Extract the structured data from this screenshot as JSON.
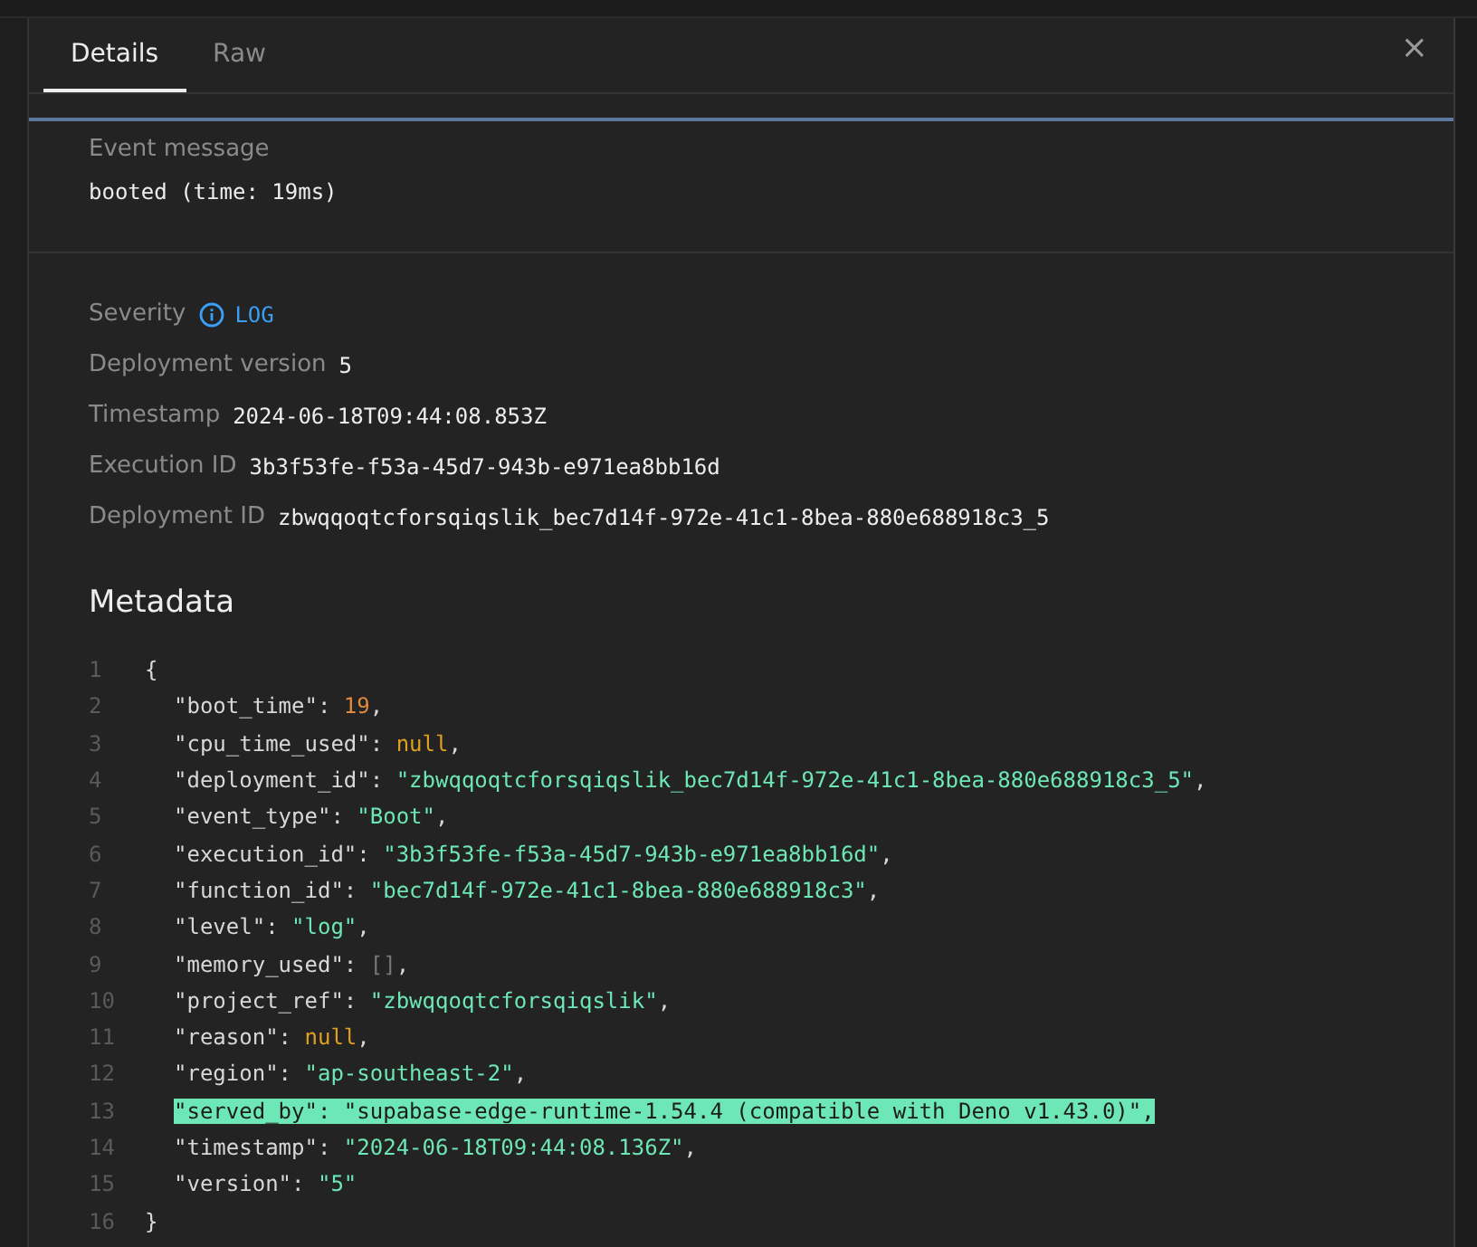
{
  "tabs": [
    {
      "label": "Details",
      "selected": true
    },
    {
      "label": "Raw",
      "selected": false
    }
  ],
  "close": "×",
  "event_message": {
    "label": "Event message",
    "value": "booted (time: 19ms)"
  },
  "fields": [
    {
      "label": "Severity",
      "value": "LOG",
      "kind": "severity"
    },
    {
      "label": "Deployment version",
      "value": "5",
      "kind": "plain"
    },
    {
      "label": "Timestamp",
      "value": "2024-06-18T09:44:08.853Z",
      "kind": "plain"
    },
    {
      "label": "Execution ID",
      "value": "3b3f53fe-f53a-45d7-943b-e971ea8bb16d",
      "kind": "plain"
    },
    {
      "label": "Deployment ID",
      "value": "zbwqqoqtcforsqiqslik_bec7d14f-972e-41c1-8bea-880e688918c3_5",
      "kind": "plain"
    }
  ],
  "metadata": {
    "title": "Metadata",
    "open": {
      "number": "1",
      "text": "{"
    },
    "entries": [
      {
        "number": "2",
        "key": "\"boot_time\"",
        "separator": ": ",
        "value": "19",
        "kind": "number",
        "trailing": ",",
        "highlighted": false
      },
      {
        "number": "3",
        "key": "\"cpu_time_used\"",
        "separator": ": ",
        "value": "null",
        "kind": "null",
        "trailing": ",",
        "highlighted": false
      },
      {
        "number": "4",
        "key": "\"deployment_id\"",
        "separator": ": ",
        "value": "\"zbwqqoqtcforsqiqslik_bec7d14f-972e-41c1-8bea-880e688918c3_5\"",
        "kind": "string",
        "trailing": ",",
        "highlighted": false
      },
      {
        "number": "5",
        "key": "\"event_type\"",
        "separator": ": ",
        "value": "\"Boot\"",
        "kind": "string",
        "trailing": ",",
        "highlighted": false
      },
      {
        "number": "6",
        "key": "\"execution_id\"",
        "separator": ": ",
        "value": "\"3b3f53fe-f53a-45d7-943b-e971ea8bb16d\"",
        "kind": "string",
        "trailing": ",",
        "highlighted": false
      },
      {
        "number": "7",
        "key": "\"function_id\"",
        "separator": ": ",
        "value": "\"bec7d14f-972e-41c1-8bea-880e688918c3\"",
        "kind": "string",
        "trailing": ",",
        "highlighted": false
      },
      {
        "number": "8",
        "key": "\"level\"",
        "separator": ": ",
        "value": "\"log\"",
        "kind": "string",
        "trailing": ",",
        "highlighted": false
      },
      {
        "number": "9",
        "key": "\"memory_used\"",
        "separator": ": ",
        "value": "[]",
        "kind": "array",
        "trailing": ",",
        "highlighted": false
      },
      {
        "number": "10",
        "key": "\"project_ref\"",
        "separator": ": ",
        "value": "\"zbwqqoqtcforsqiqslik\"",
        "kind": "string",
        "trailing": ",",
        "highlighted": false
      },
      {
        "number": "11",
        "key": "\"reason\"",
        "separator": ": ",
        "value": "null",
        "kind": "null",
        "trailing": ",",
        "highlighted": false
      },
      {
        "number": "12",
        "key": "\"region\"",
        "separator": ": ",
        "value": "\"ap-southeast-2\"",
        "kind": "string",
        "trailing": ",",
        "highlighted": false
      },
      {
        "number": "13",
        "key": "\"served_by\"",
        "separator": ": ",
        "value": "\"supabase-edge-runtime-1.54.4 (compatible with Deno v1.43.0)\"",
        "kind": "string",
        "trailing": ",",
        "highlighted": true
      },
      {
        "number": "14",
        "key": "\"timestamp\"",
        "separator": ": ",
        "value": "\"2024-06-18T09:44:08.136Z\"",
        "kind": "string",
        "trailing": ",",
        "highlighted": false
      },
      {
        "number": "15",
        "key": "\"version\"",
        "separator": ": ",
        "value": "\"5\"",
        "kind": "string",
        "highlighted": false
      }
    ],
    "close": {
      "number": "16",
      "text": "}"
    }
  }
}
